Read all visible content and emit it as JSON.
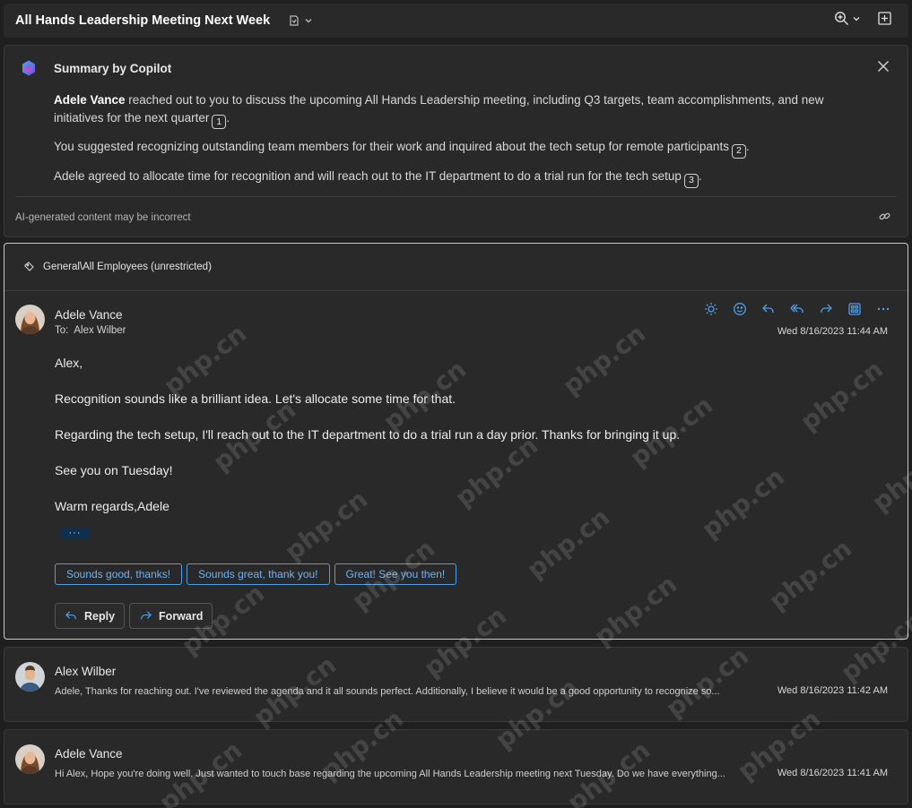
{
  "header": {
    "title": "All Hands Leadership Meeting Next Week"
  },
  "summary": {
    "heading": "Summary by Copilot",
    "p1_name": "Adele Vance",
    "p1_text": " reached out to you to discuss the upcoming All Hands Leadership meeting, including Q3 targets, team accomplishments, and new initiatives for the next quarter",
    "p1_cite": "1",
    "p2_text": "You suggested recognizing outstanding team members for their work and inquired about the tech setup for remote participants",
    "p2_cite": "2",
    "p3_text": "Adele agreed to allocate time for recognition and will reach out to the IT department to do a trial run for the tech setup",
    "p3_cite": "3",
    "period": ".",
    "disclaimer": "AI-generated content may be incorrect"
  },
  "message": {
    "sensitivity": "General\\All Employees (unrestricted)",
    "sender": "Adele Vance",
    "to_label": "To:",
    "to_name": "Alex Wilber",
    "date": "Wed 8/16/2023 11:44 AM",
    "body": [
      "Alex,",
      "Recognition sounds like a brilliant idea. Let's allocate some time for that.",
      "Regarding the tech setup, I'll reach out to the IT department to do a trial run a day prior. Thanks for bringing it up.",
      "See you on Tuesday!",
      "Warm regards,Adele"
    ],
    "ellipsis": "···",
    "quick_replies": [
      "Sounds good, thanks!",
      "Sounds great, thank you!",
      "Great! See you then!"
    ],
    "reply_label": "Reply",
    "forward_label": "Forward"
  },
  "thread": [
    {
      "sender": "Alex Wilber",
      "preview": "Adele, Thanks for reaching out. I've reviewed the agenda and it all sounds perfect. Additionally, I believe it would be a good opportunity to recognize so...",
      "date": "Wed 8/16/2023 11:42 AM"
    },
    {
      "sender": "Adele Vance",
      "preview": "Hi Alex, Hope you're doing well. Just wanted to touch base regarding the upcoming All Hands Leadership meeting next Tuesday. Do we have everything...",
      "date": "Wed 8/16/2023 11:41 AM"
    }
  ],
  "watermark": "php.cn",
  "colors": {
    "background": "#1f1f1f",
    "card": "#292929",
    "accent": "#4f9ee8",
    "text": "#e8e8e8"
  }
}
